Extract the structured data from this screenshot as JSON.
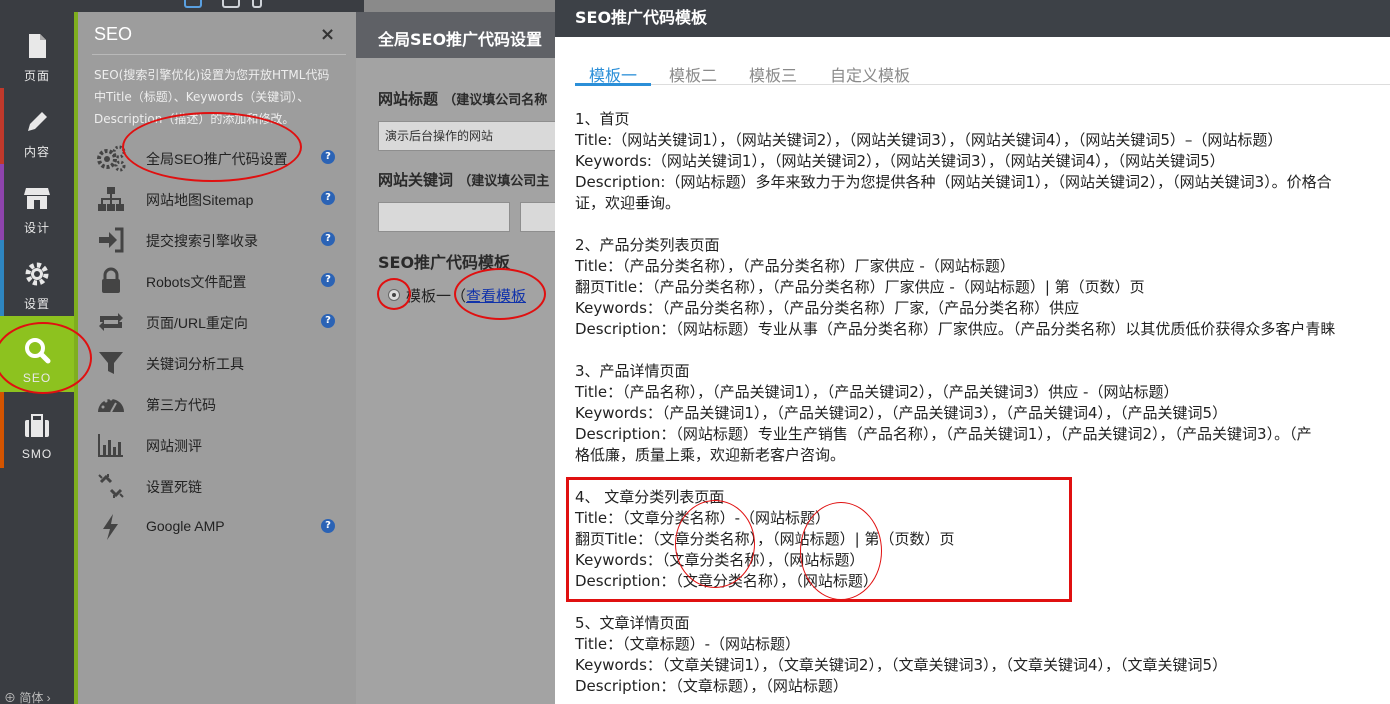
{
  "rail": [
    {
      "label": "页面",
      "icon": "page-icon"
    },
    {
      "label": "内容",
      "icon": "pencil-icon"
    },
    {
      "label": "设计",
      "icon": "store-icon"
    },
    {
      "label": "设置",
      "icon": "gear-icon"
    },
    {
      "label": "SEO",
      "icon": "search-icon",
      "active": true
    },
    {
      "label": "SMO",
      "icon": "briefcase-icon"
    }
  ],
  "rail_lang": "⊕ 简体 ›",
  "seo_panel": {
    "title": "SEO",
    "close": "×",
    "description": "SEO(搜索引擎优化)设置为您开放HTML代码中Title（标题）、Keywords（关键词）、Description（描述）的添加和修改。",
    "items": [
      {
        "label": "全局SEO推广代码设置",
        "icon": "gears-icon",
        "help": true
      },
      {
        "label": "网站地图Sitemap",
        "icon": "sitemap-icon",
        "help": true
      },
      {
        "label": "提交搜索引擎收录",
        "icon": "sign-in-icon",
        "help": true
      },
      {
        "label": "Robots文件配置",
        "icon": "lock-icon",
        "help": true
      },
      {
        "label": "页面/URL重定向",
        "icon": "retweet-icon",
        "help": true
      },
      {
        "label": "关键词分析工具",
        "icon": "filter-icon",
        "help": false
      },
      {
        "label": "第三方代码",
        "icon": "dashboard-icon",
        "help": false
      },
      {
        "label": "网站测评",
        "icon": "bar-chart-icon",
        "help": false
      },
      {
        "label": "设置死链",
        "icon": "broken-link-icon",
        "help": false
      },
      {
        "label": "Google AMP",
        "icon": "bolt-icon",
        "help": true
      }
    ],
    "help_glyph": "?"
  },
  "mid_panel": {
    "title": "全局SEO推广代码设置",
    "site_title_label": "网站标题",
    "site_title_hint": "（建议填公司名称",
    "site_title_value": "演示后台操作的网站",
    "site_keywords_label": "网站关键词",
    "site_keywords_hint": "（建议填公司主",
    "template_label": "SEO推广代码模板",
    "radio_label": "模板一（",
    "view_link": "查看模板"
  },
  "modal": {
    "title": "SEO推广代码模板",
    "tabs": [
      "模板一",
      "模板二",
      "模板三",
      "自定义模板"
    ],
    "lines": [
      "1、首页",
      "Title:（网站关键词1），（网站关键词2），（网站关键词3），（网站关键词4），（网站关键词5）–（网站标题）",
      "Keywords:（网站关键词1），（网站关键词2），（网站关键词3），（网站关键词4），（网站关键词5）",
      "Description:（网站标题）多年来致力于为您提供各种（网站关键词1），（网站关键词2），（网站关键词3）。价格合",
      "证，欢迎垂询。",
      "2、产品分类列表页面",
      "Title：（产品分类名称），（产品分类名称）厂家供应 -（网站标题）",
      "翻页Title：（产品分类名称），（产品分类名称）厂家供应 -（网站标题）| 第（页数）页",
      "Keywords：（产品分类名称），（产品分类名称）厂家,（产品分类名称）供应",
      "Description：（网站标题）专业从事（产品分类名称）厂家供应。（产品分类名称）以其优质低价获得众多客户青睐",
      "3、产品详情页面",
      "Title：（产品名称），（产品关键词1），（产品关键词2），（产品关键词3）供应 -（网站标题）",
      "Keywords：（产品关键词1），（产品关键词2），（产品关键词3），（产品关键词4），（产品关键词5）",
      "Description：（网站标题）专业生产销售（产品名称），（产品关键词1），（产品关键词2），（产品关键词3）。（产",
      "格低廉，质量上乘，欢迎新老客户咨询。",
      "4、 文章分类列表页面",
      "Title：（文章分类名称）-（网站标题）",
      "翻页Title：（文章分类名称），（网站标题）| 第（页数）页",
      "Keywords：（文章分类名称），（网站标题）",
      "Description：（文章分类名称），（网站标题）",
      "5、文章详情页面",
      "Title：（文章标题）-（网站标题）",
      "Keywords：（文章关键词1），（文章关键词2），（文章关键词3），（文章关键词4），（文章关键词5）",
      "Description：（文章标题），（网站标题）"
    ]
  },
  "colors": {
    "accent_green": "#8dc21f",
    "link_blue": "#2b8fd8",
    "annotation_red": "#e01010"
  }
}
